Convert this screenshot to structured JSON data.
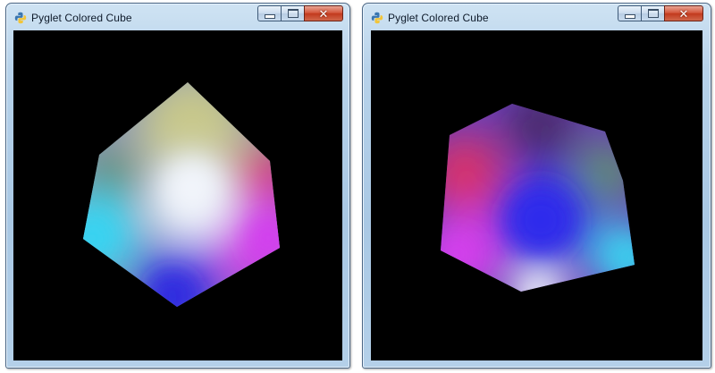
{
  "windows": [
    {
      "title": "Pyglet Colored Cube",
      "icon": "python-logo-icon",
      "controls": [
        "minimize",
        "maximize",
        "close"
      ],
      "scene": "colored cube (view 1)"
    },
    {
      "title": "Pyglet Colored Cube",
      "icon": "python-logo-icon",
      "controls": [
        "minimize",
        "maximize",
        "close"
      ],
      "scene": "colored cube (view 2)"
    }
  ],
  "colors": {
    "viewport_background": "#000000",
    "titlebar": "#b7d2ea",
    "close_button": "#c9452a",
    "cube_white": "#e6ecf6",
    "cube_khaki": "#c8c88a",
    "cube_cyan": "#3fd2ee",
    "cube_magenta": "#cf40e6",
    "cube_blue": "#3b36df",
    "cube_red": "#d9336a",
    "cube_green": "#5f9070"
  }
}
